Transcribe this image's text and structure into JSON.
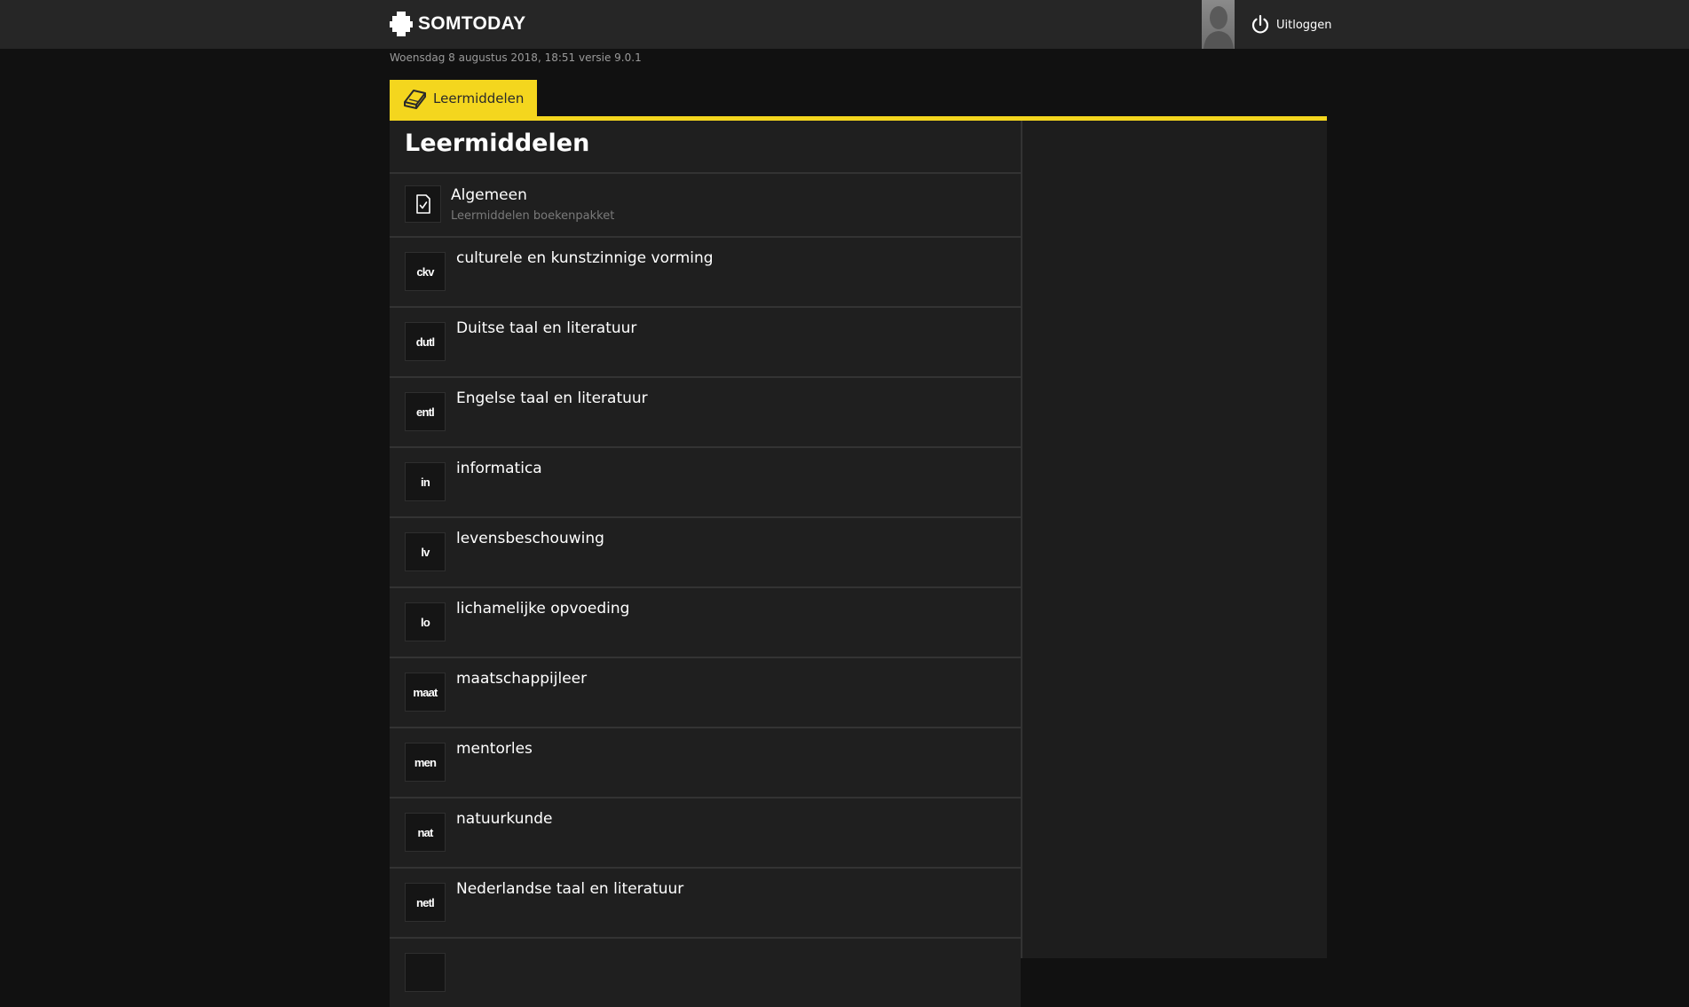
{
  "header": {
    "logo_text": "SOMTODAY",
    "logout_label": "Uitloggen"
  },
  "datestamp": "Woensdag 8 augustus 2018, 18:51 versie 9.0.1",
  "tab": {
    "label": "Leermiddelen"
  },
  "panel": {
    "title": "Leermiddelen"
  },
  "first_item": {
    "title": "Algemeen",
    "subtitle": "Leermiddelen boekenpakket"
  },
  "subjects": [
    {
      "code": "ckv",
      "title": "culturele en kunstzinnige vorming"
    },
    {
      "code": "dutl",
      "title": "Duitse taal en literatuur"
    },
    {
      "code": "entl",
      "title": "Engelse taal en literatuur"
    },
    {
      "code": "in",
      "title": "informatica"
    },
    {
      "code": "lv",
      "title": "levensbeschouwing"
    },
    {
      "code": "lo",
      "title": "lichamelijke opvoeding"
    },
    {
      "code": "maat",
      "title": "maatschappijleer"
    },
    {
      "code": "men",
      "title": "mentorles"
    },
    {
      "code": "nat",
      "title": "natuurkunde"
    },
    {
      "code": "netl",
      "title": "Nederlandse taal en literatuur"
    }
  ],
  "colors": {
    "accent": "#f4d61e",
    "topbar": "#262626",
    "panel": "#1f1f1f"
  }
}
